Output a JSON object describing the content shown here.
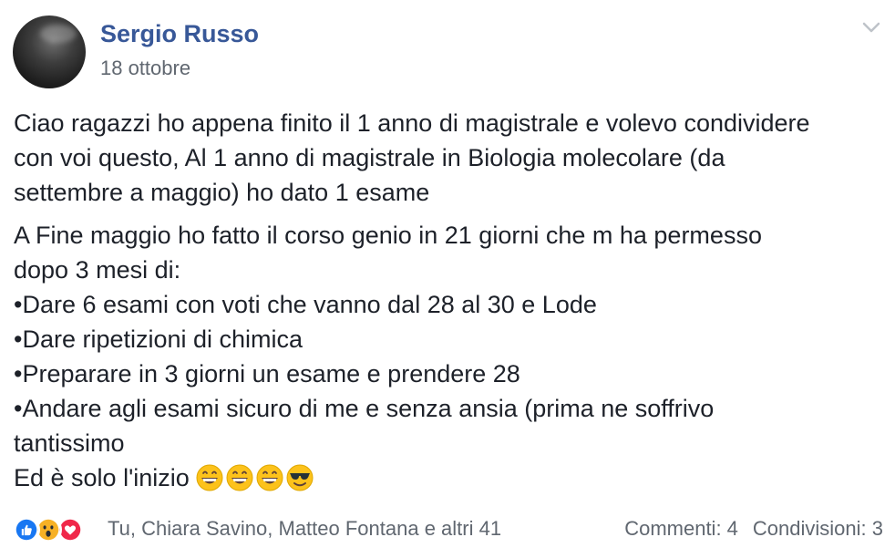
{
  "post": {
    "author": "Sergio Russo",
    "date": "18 ottobre",
    "menu_icon": "chevron-down-icon",
    "paragraphs": [
      [
        "Ciao ragazzi ho appena finito il 1 anno di magistrale e volevo condividere",
        "con voi questo, Al 1 anno di magistrale in Biologia molecolare (da",
        "settembre a maggio) ho dato 1 esame"
      ],
      [
        "A Fine maggio ho fatto il corso genio in 21 giorni che m ha permesso",
        "dopo 3 mesi di:",
        "•Dare 6 esami con voti che vanno dal 28 al 30 e Lode",
        "•Dare ripetizioni di chimica",
        "•Preparare in 3 giorni un esame e prendere 28",
        "•Andare agli esami sicuro di me e senza ansia (prima ne soffrivo",
        "tantissimo",
        "Ed è solo l'inizio"
      ]
    ],
    "emojis": [
      "grinning-face-icon",
      "grinning-face-icon",
      "grinning-face-icon",
      "sunglasses-face-icon"
    ]
  },
  "footer": {
    "reactions": [
      "like-icon",
      "wow-icon",
      "love-icon"
    ],
    "likers_text": "Tu, Chiara Savino, Matteo Fontana e altri 41",
    "comments": "Commenti: 4",
    "shares": "Condivisioni: 3"
  },
  "colors": {
    "author": "#385898",
    "secondary_text": "#606770",
    "body_text": "#1d2129",
    "like": "#1877f2",
    "wow": "#f7b125",
    "love": "#f0284a"
  }
}
